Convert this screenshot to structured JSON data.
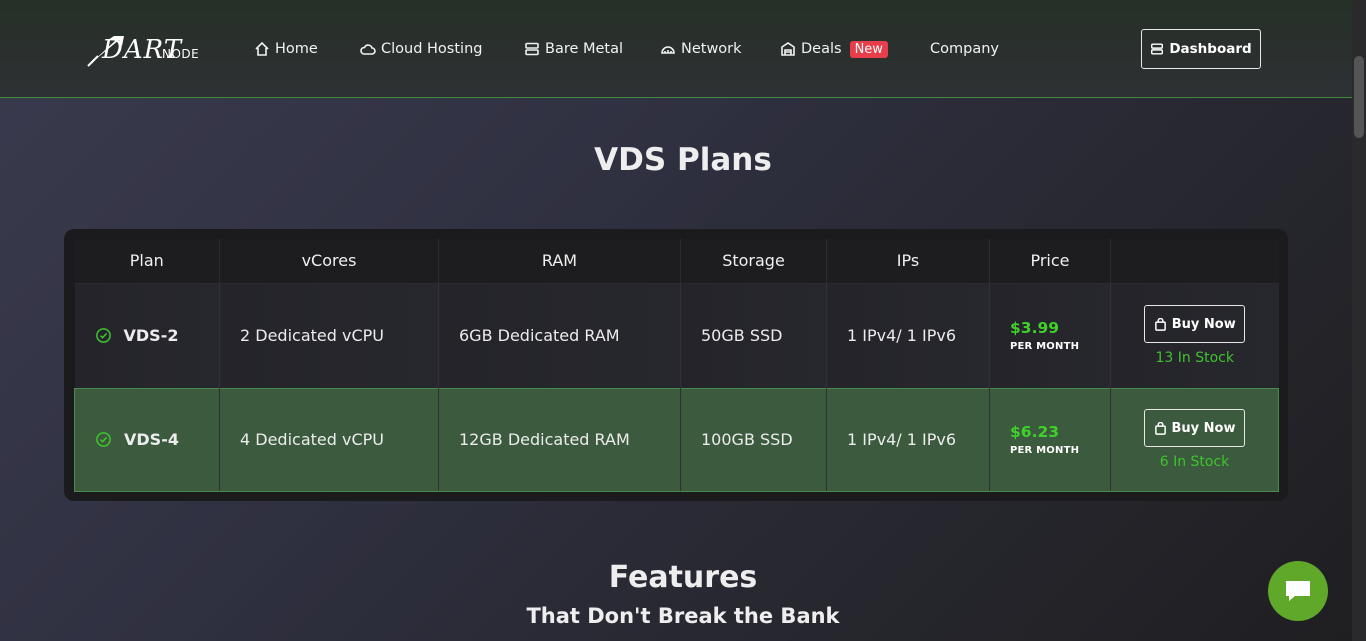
{
  "header": {
    "logo_text": "DART",
    "logo_sub": "NODE",
    "nav": [
      {
        "label": "Home",
        "icon": "home-icon"
      },
      {
        "label": "Cloud Hosting",
        "icon": "cloud-icon"
      },
      {
        "label": "Bare Metal",
        "icon": "server-icon"
      },
      {
        "label": "Network",
        "icon": "network-icon"
      },
      {
        "label": "Deals",
        "icon": "store-icon",
        "badge": "New"
      },
      {
        "label": "Company"
      }
    ],
    "dashboard_label": "Dashboard"
  },
  "plans_section": {
    "title": "VDS Plans",
    "columns": [
      "Plan",
      "vCores",
      "RAM",
      "Storage",
      "IPs",
      "Price",
      ""
    ],
    "rows": [
      {
        "plan": "VDS-2",
        "vcores": "2 Dedicated vCPU",
        "ram": "6GB Dedicated RAM",
        "storage": "50GB SSD",
        "ips": "1 IPv4/ 1 IPv6",
        "price": "$3.99",
        "period": "PER MONTH",
        "buy_label": "Buy Now",
        "stock": "13 In Stock"
      },
      {
        "plan": "VDS-4",
        "vcores": "4 Dedicated vCPU",
        "ram": "12GB Dedicated RAM",
        "storage": "100GB SSD",
        "ips": "1 IPv4/ 1 IPv6",
        "price": "$6.23",
        "period": "PER MONTH",
        "buy_label": "Buy Now",
        "stock": "6 In Stock"
      }
    ]
  },
  "features_section": {
    "title": "Features",
    "subtitle": "That Don't Break the Bank"
  },
  "colors": {
    "accent_green": "#3fd12a",
    "highlight_row": "#3b5a3e",
    "badge_red": "#e83d4a",
    "chat_green": "#5fa82a"
  }
}
